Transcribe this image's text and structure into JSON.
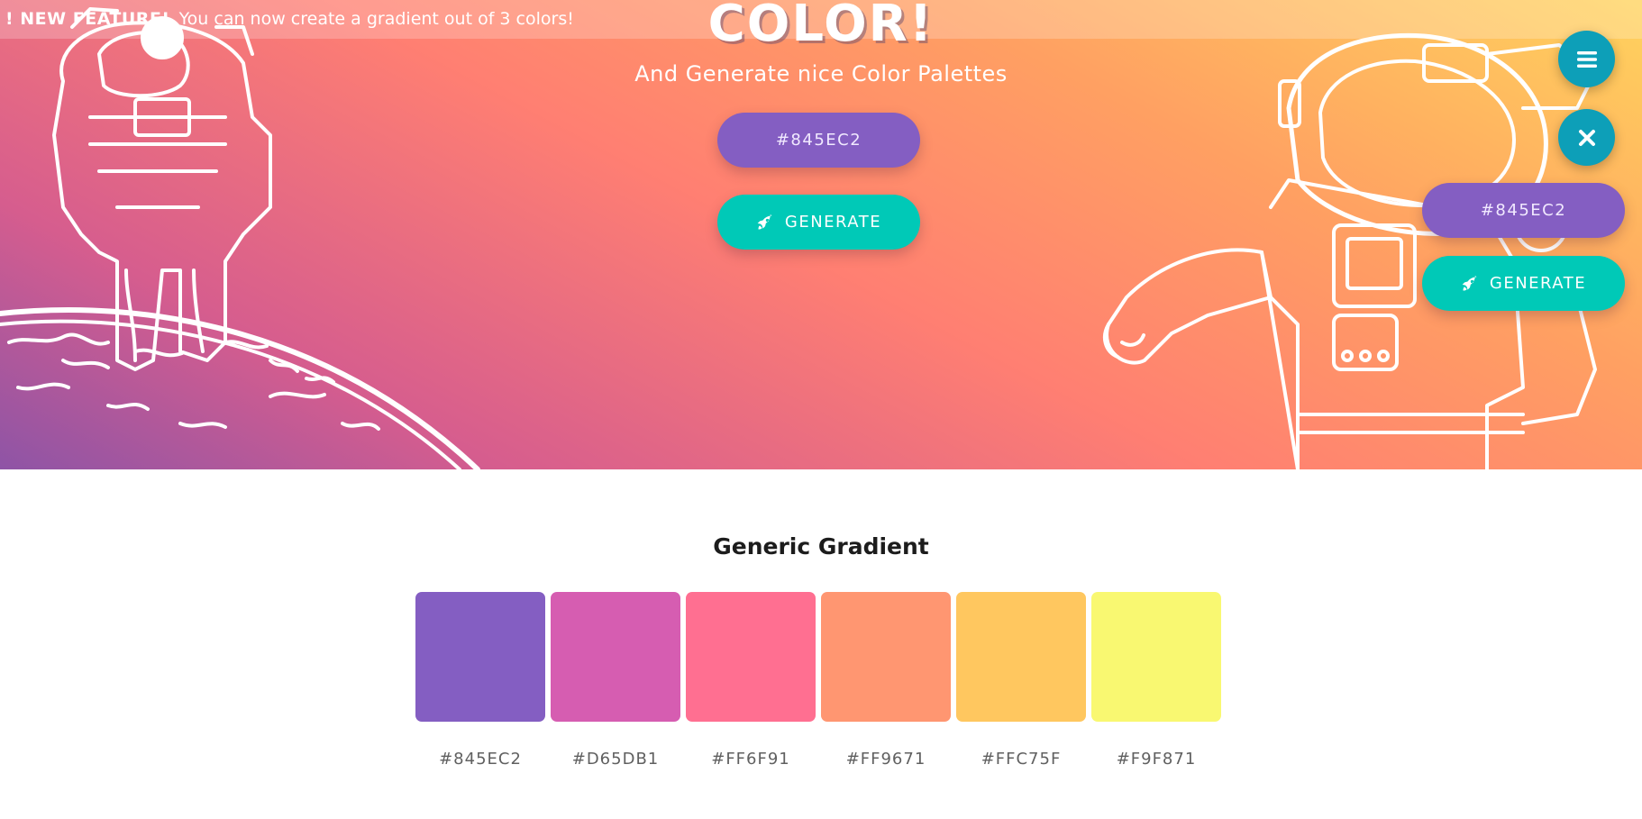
{
  "announcement": {
    "tag": "! NEW FEATURE!",
    "message": "You can now create a gradient out of 3 colors!"
  },
  "hero": {
    "title": "COLOR!",
    "subtitle": "And Generate nice Color Palettes",
    "color_button_label": "#845EC2",
    "generate_label": "GENERATE"
  },
  "floating_menu": {
    "menu_icon": "hamburger-icon",
    "close_icon": "close-icon",
    "color_button_label": "#845EC2",
    "generate_label": "GENERATE"
  },
  "palette": {
    "title": "Generic Gradient",
    "swatches": [
      {
        "hex": "#845EC2",
        "color": "#845ec2"
      },
      {
        "hex": "#D65DB1",
        "color": "#d65db1"
      },
      {
        "hex": "#FF6F91",
        "color": "#ff6f91"
      },
      {
        "hex": "#FF9671",
        "color": "#ff9671"
      },
      {
        "hex": "#FFC75F",
        "color": "#ffc75f"
      },
      {
        "hex": "#F9F871",
        "color": "#f9f871"
      }
    ]
  },
  "colors": {
    "primary_purple": "#845ec2",
    "accent_teal": "#00c9b7",
    "fab_blue": "#0d9fb8"
  }
}
